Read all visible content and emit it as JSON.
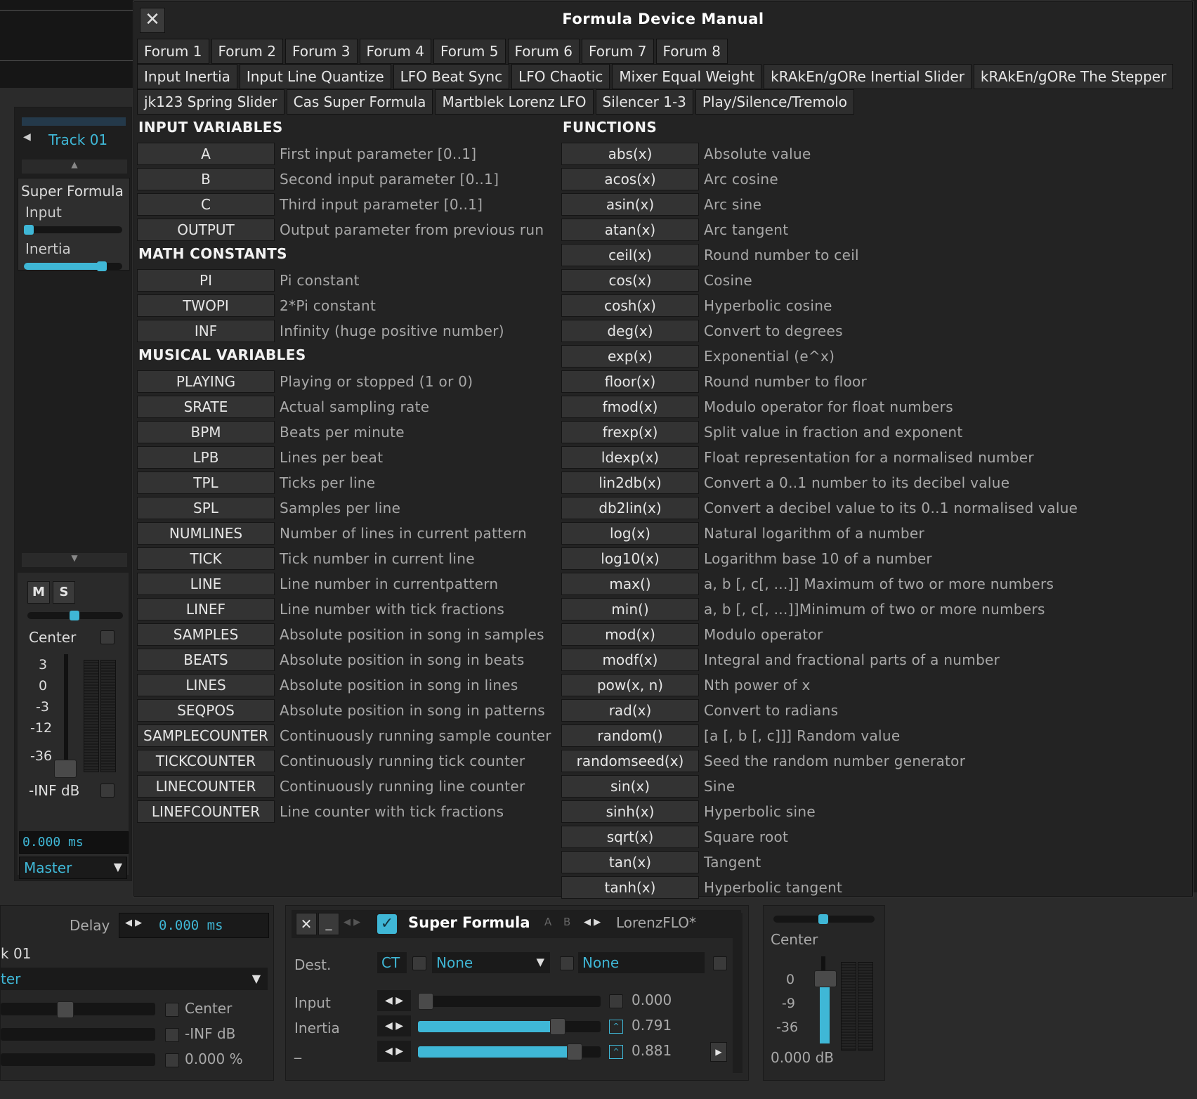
{
  "dialog": {
    "title": "Formula Device Manual",
    "close_glyph": "✕",
    "tabs_row1": [
      "Forum 1",
      "Forum 2",
      "Forum 3",
      "Forum 4",
      "Forum 5",
      "Forum 6",
      "Forum 7",
      "Forum 8"
    ],
    "tabs_row2": [
      "Input Inertia",
      "Input Line Quantize",
      "LFO Beat Sync",
      "LFO Chaotic",
      "Mixer Equal Weight",
      "kRAkEn/gORe Inertial Slider",
      "kRAkEn/gORe The Stepper"
    ],
    "tabs_row3": [
      "jk123 Spring Slider",
      "Cas Super Formula",
      "Martblek Lorenz LFO",
      "Silencer 1-3",
      "Play/Silence/Tremolo"
    ],
    "sections": {
      "input_variables": "INPUT VARIABLES",
      "math_constants": "MATH CONSTANTS",
      "musical_variables": "MUSICAL VARIABLES",
      "functions": "FUNCTIONS"
    },
    "input_variables": [
      {
        "key": "A",
        "desc": "First input parameter [0..1]"
      },
      {
        "key": "B",
        "desc": "Second input parameter [0..1]"
      },
      {
        "key": "C",
        "desc": "Third input parameter [0..1]"
      },
      {
        "key": "OUTPUT",
        "desc": "Output parameter from previous run"
      }
    ],
    "math_constants": [
      {
        "key": "PI",
        "desc": "Pi constant"
      },
      {
        "key": "TWOPI",
        "desc": "2*Pi constant"
      },
      {
        "key": "INF",
        "desc": "Infinity (huge positive number)"
      }
    ],
    "musical_variables": [
      {
        "key": "PLAYING",
        "desc": "Playing or stopped (1 or 0)"
      },
      {
        "key": "SRATE",
        "desc": "Actual sampling rate"
      },
      {
        "key": "BPM",
        "desc": "Beats per minute"
      },
      {
        "key": "LPB",
        "desc": "Lines per beat"
      },
      {
        "key": "TPL",
        "desc": "Ticks per line"
      },
      {
        "key": "SPL",
        "desc": "Samples per line"
      },
      {
        "key": "NUMLINES",
        "desc": "Number of lines in current pattern"
      },
      {
        "key": "TICK",
        "desc": "Tick number in current line"
      },
      {
        "key": "LINE",
        "desc": "Line number in currentpattern"
      },
      {
        "key": "LINEF",
        "desc": "Line number with tick fractions"
      },
      {
        "key": "SAMPLES",
        "desc": "Absolute position in song in samples"
      },
      {
        "key": "BEATS",
        "desc": "Absolute position in song in beats"
      },
      {
        "key": "LINES",
        "desc": "Absolute position in song in lines"
      },
      {
        "key": "SEQPOS",
        "desc": "Absolute position in song in patterns"
      },
      {
        "key": "SAMPLECOUNTER",
        "desc": "Continuously running sample counter"
      },
      {
        "key": "TICKCOUNTER",
        "desc": "Continuously running tick counter"
      },
      {
        "key": "LINECOUNTER",
        "desc": "Continuously running line counter"
      },
      {
        "key": "LINEFCOUNTER",
        "desc": "Line counter with tick fractions"
      }
    ],
    "functions": [
      {
        "key": "abs(x)",
        "desc": "Absolute value"
      },
      {
        "key": "acos(x)",
        "desc": "Arc cosine"
      },
      {
        "key": "asin(x)",
        "desc": "Arc sine"
      },
      {
        "key": "atan(x)",
        "desc": "Arc tangent"
      },
      {
        "key": "ceil(x)",
        "desc": "Round number to ceil"
      },
      {
        "key": "cos(x)",
        "desc": "Cosine"
      },
      {
        "key": "cosh(x)",
        "desc": "Hyperbolic cosine"
      },
      {
        "key": "deg(x)",
        "desc": "Convert to degrees"
      },
      {
        "key": "exp(x)",
        "desc": "Exponential (e^x)"
      },
      {
        "key": "floor(x)",
        "desc": "Round number to floor"
      },
      {
        "key": "fmod(x)",
        "desc": "Modulo operator for float numbers"
      },
      {
        "key": "frexp(x)",
        "desc": "Split value in fraction and exponent"
      },
      {
        "key": "ldexp(x)",
        "desc": "Float representation for a normalised number"
      },
      {
        "key": "lin2db(x)",
        "desc": "Convert a 0..1 number to its decibel value"
      },
      {
        "key": "db2lin(x)",
        "desc": "Convert a decibel value to its 0..1 normalised value"
      },
      {
        "key": "log(x)",
        "desc": "Natural logarithm of a number"
      },
      {
        "key": "log10(x)",
        "desc": "Logarithm base 10 of a number"
      },
      {
        "key": "max()",
        "desc": "a, b [, c[, ...]] Maximum of two or more numbers"
      },
      {
        "key": "min()",
        "desc": "a, b [, c[, ...]]Minimum of two or more numbers"
      },
      {
        "key": "mod(x)",
        "desc": "Modulo operator"
      },
      {
        "key": "modf(x)",
        "desc": "Integral and fractional parts of a number"
      },
      {
        "key": "pow(x, n)",
        "desc": "Nth power of x"
      },
      {
        "key": "rad(x)",
        "desc": "Convert to radians"
      },
      {
        "key": "random()",
        "desc": "[a [, b [, c]]] Random value"
      },
      {
        "key": "randomseed(x)",
        "desc": "Seed the random number generator"
      },
      {
        "key": "sin(x)",
        "desc": "Sine"
      },
      {
        "key": "sinh(x)",
        "desc": "Hyperbolic sine"
      },
      {
        "key": "sqrt(x)",
        "desc": "Square root"
      },
      {
        "key": "tan(x)",
        "desc": "Tangent"
      },
      {
        "key": "tanh(x)",
        "desc": "Hyperbolic tangent"
      }
    ]
  },
  "mixer": {
    "track_name": "Track 01",
    "device_name": "Super Formula",
    "param_input": "Input",
    "param_inertia": "Inertia",
    "input_level": 0.0,
    "inertia_level": 0.791,
    "mute_label": "M",
    "solo_label": "S",
    "pan_label": "Center",
    "scale_ticks": [
      "3",
      "0",
      "-3",
      "-12",
      "-36"
    ],
    "volume_label": "-INF dB",
    "delay_value": "0.000  ms",
    "routing": "Master"
  },
  "track_dsp": {
    "delay_label": "Delay",
    "delay_value": "0.000  ms",
    "track_label_partial": "k 01",
    "routing_partial": "ter",
    "pan_label": "Center",
    "volume_label": "-INF dB",
    "width_label": "0.000 %"
  },
  "device_panel": {
    "name": "Super Formula",
    "preset": "LorenzFLO*",
    "ab_label": "A B",
    "dest_label": "Dest.",
    "dest_ct": "CT",
    "dest_none1": "None",
    "dest_none2": "None",
    "input_label": "Input",
    "inertia_label": "Inertia",
    "third_label": "_",
    "input_value": "0.000",
    "inertia_value": "0.791",
    "third_value": "0.881",
    "input_level": 0.0,
    "inertia_level": 0.791,
    "third_level": 0.881
  },
  "master": {
    "pan_label": "Center",
    "ticks": [
      "0",
      "-9",
      "-36"
    ],
    "db_value": "0.000 dB"
  },
  "colors": {
    "accent": "#3fb7d6",
    "dialog_bg": "#232323",
    "key_bg": "#333333"
  }
}
